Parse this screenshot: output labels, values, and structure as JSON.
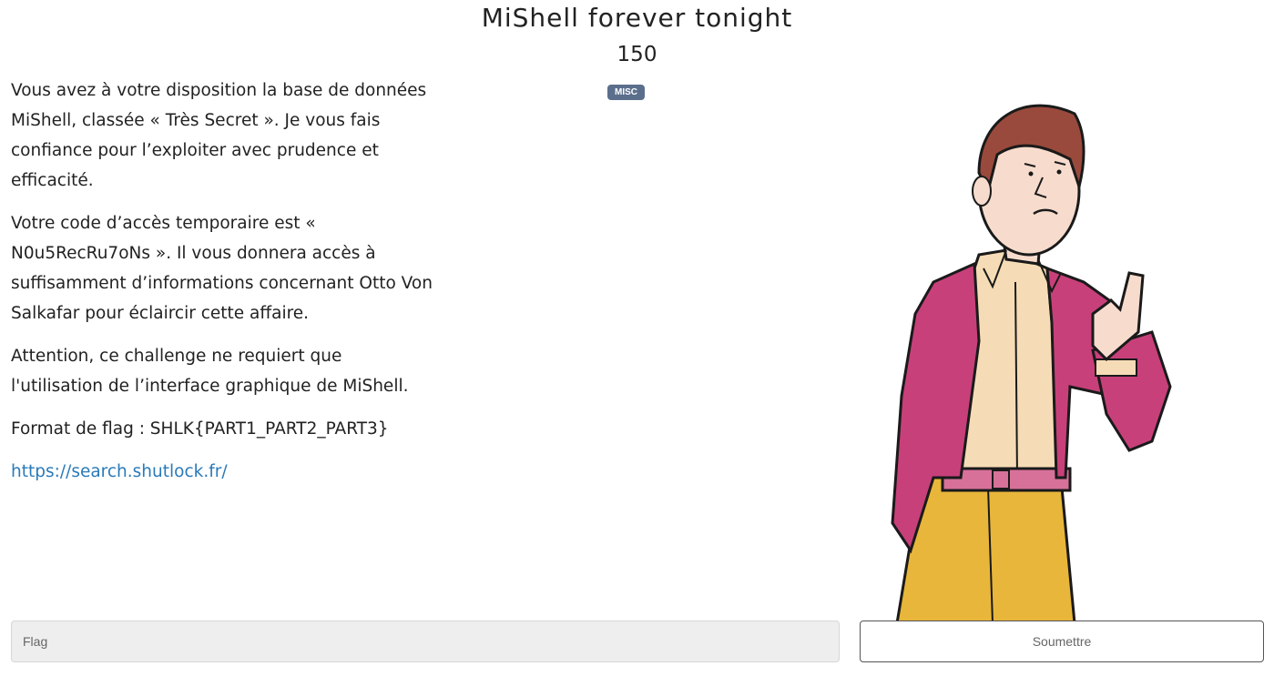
{
  "challenge": {
    "title": "MiShell forever tonight",
    "points": "150",
    "category": "MISC"
  },
  "description": {
    "paragraph1": "Vous avez à votre disposition la base de données MiShell, classée « Très Secret ». Je vous fais confiance pour l’exploiter avec prudence et efficacité.",
    "paragraph2": "Votre code d’accès temporaire est « N0u5RecRu7oNs ». Il vous donnera accès à suffisamment d’informations concernant Otto Von Salkafar pour éclaircir cette affaire.",
    "paragraph3": "Attention, ce challenge ne requiert que l'utilisation de l’interface graphique de MiShell.",
    "paragraph4": "Format de flag : SHLK{PART1_PART2_PART3}",
    "link": "https://search.shutlock.fr/"
  },
  "form": {
    "flag_placeholder": "Flag",
    "flag_value": "",
    "submit_label": "Soumettre"
  },
  "colors": {
    "tag_bg": "#5b6f8c",
    "link": "#2a7ab8",
    "jacket": "#c8407a",
    "trousers": "#e8b63a",
    "shirt": "#f6dcb6",
    "hair": "#9a4a3c",
    "skin": "#f7dccd"
  }
}
